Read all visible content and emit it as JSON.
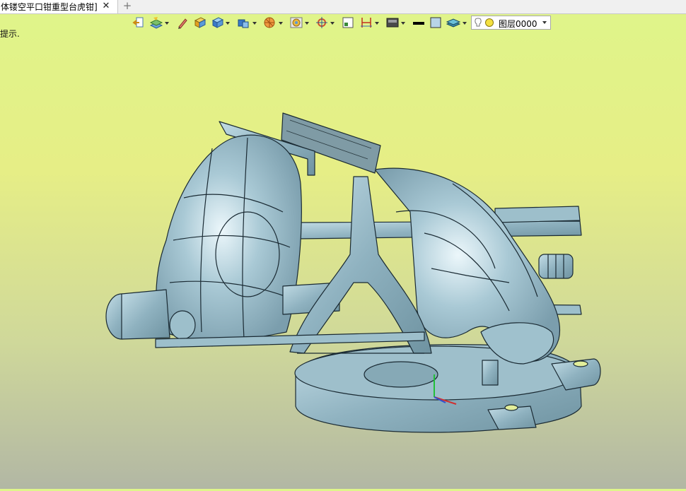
{
  "tab": {
    "title": "体镂空平口钳重型台虎钳]",
    "close": "✕",
    "add": "+"
  },
  "hint": {
    "text": "提示."
  },
  "toolbar": {
    "layer": {
      "value": "图层0000"
    },
    "icons": [
      "exit-icon",
      "layer-tools-icon",
      "pen-icon",
      "solid-box-icon",
      "cube-view-icon",
      "display-mode-icon",
      "render-style-icon",
      "material-icon",
      "snap-icon",
      "select-filter-icon",
      "dimension-icon",
      "background-icon",
      "line-style-icon",
      "color-swatch-icon",
      "layer-stack-icon",
      "bulb-icon",
      "layer-color-icon"
    ]
  },
  "colors": {
    "accent": "#8fb2c0",
    "edge": "#1a2a33",
    "bg_top": "#dff58a",
    "bg_bottom": "#b2b7a4"
  }
}
